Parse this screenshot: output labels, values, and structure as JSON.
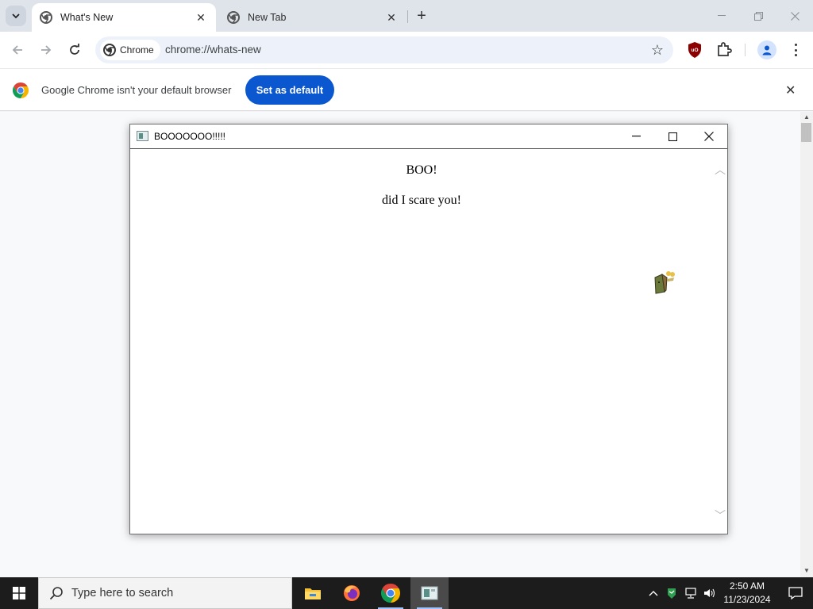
{
  "browser": {
    "tabs": [
      {
        "title": "What's New",
        "active": true
      },
      {
        "title": "New Tab",
        "active": false
      }
    ],
    "omnibox": {
      "chip": "Chrome",
      "url": "chrome://whats-new"
    },
    "colors": {
      "accent": "#0b57d0",
      "tabstrip": "#dfe3ea"
    }
  },
  "infobar": {
    "message": "Google Chrome isn't your default browser",
    "button": "Set as default"
  },
  "popup": {
    "title": "BOOOOOOO!!!!!",
    "heading": "BOO!",
    "message": "did I scare you!"
  },
  "taskbar": {
    "search_placeholder": "Type here to search",
    "apps": [
      "file-explorer",
      "firefox",
      "chrome",
      "popup-app"
    ],
    "time": "2:50 AM",
    "date": "11/23/2024"
  }
}
